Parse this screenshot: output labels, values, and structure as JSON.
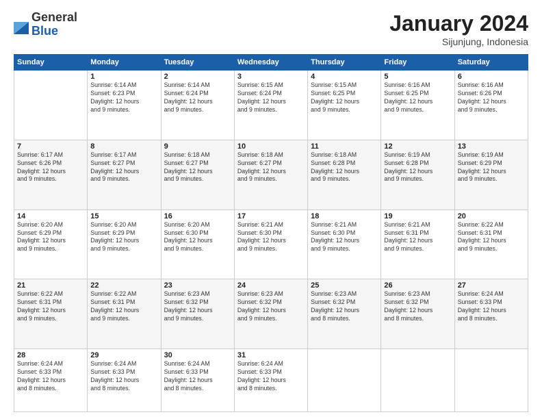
{
  "logo": {
    "general": "General",
    "blue": "Blue"
  },
  "header": {
    "month_year": "January 2024",
    "location": "Sijunjung, Indonesia"
  },
  "days_of_week": [
    "Sunday",
    "Monday",
    "Tuesday",
    "Wednesday",
    "Thursday",
    "Friday",
    "Saturday"
  ],
  "weeks": [
    [
      {
        "day": null,
        "info": null
      },
      {
        "day": "1",
        "info": "Sunrise: 6:14 AM\nSunset: 6:23 PM\nDaylight: 12 hours\nand 9 minutes."
      },
      {
        "day": "2",
        "info": "Sunrise: 6:14 AM\nSunset: 6:24 PM\nDaylight: 12 hours\nand 9 minutes."
      },
      {
        "day": "3",
        "info": "Sunrise: 6:15 AM\nSunset: 6:24 PM\nDaylight: 12 hours\nand 9 minutes."
      },
      {
        "day": "4",
        "info": "Sunrise: 6:15 AM\nSunset: 6:25 PM\nDaylight: 12 hours\nand 9 minutes."
      },
      {
        "day": "5",
        "info": "Sunrise: 6:16 AM\nSunset: 6:25 PM\nDaylight: 12 hours\nand 9 minutes."
      },
      {
        "day": "6",
        "info": "Sunrise: 6:16 AM\nSunset: 6:26 PM\nDaylight: 12 hours\nand 9 minutes."
      }
    ],
    [
      {
        "day": "7",
        "info": "Sunrise: 6:17 AM\nSunset: 6:26 PM\nDaylight: 12 hours\nand 9 minutes."
      },
      {
        "day": "8",
        "info": "Sunrise: 6:17 AM\nSunset: 6:27 PM\nDaylight: 12 hours\nand 9 minutes."
      },
      {
        "day": "9",
        "info": "Sunrise: 6:18 AM\nSunset: 6:27 PM\nDaylight: 12 hours\nand 9 minutes."
      },
      {
        "day": "10",
        "info": "Sunrise: 6:18 AM\nSunset: 6:27 PM\nDaylight: 12 hours\nand 9 minutes."
      },
      {
        "day": "11",
        "info": "Sunrise: 6:18 AM\nSunset: 6:28 PM\nDaylight: 12 hours\nand 9 minutes."
      },
      {
        "day": "12",
        "info": "Sunrise: 6:19 AM\nSunset: 6:28 PM\nDaylight: 12 hours\nand 9 minutes."
      },
      {
        "day": "13",
        "info": "Sunrise: 6:19 AM\nSunset: 6:29 PM\nDaylight: 12 hours\nand 9 minutes."
      }
    ],
    [
      {
        "day": "14",
        "info": "Sunrise: 6:20 AM\nSunset: 6:29 PM\nDaylight: 12 hours\nand 9 minutes."
      },
      {
        "day": "15",
        "info": "Sunrise: 6:20 AM\nSunset: 6:29 PM\nDaylight: 12 hours\nand 9 minutes."
      },
      {
        "day": "16",
        "info": "Sunrise: 6:20 AM\nSunset: 6:30 PM\nDaylight: 12 hours\nand 9 minutes."
      },
      {
        "day": "17",
        "info": "Sunrise: 6:21 AM\nSunset: 6:30 PM\nDaylight: 12 hours\nand 9 minutes."
      },
      {
        "day": "18",
        "info": "Sunrise: 6:21 AM\nSunset: 6:30 PM\nDaylight: 12 hours\nand 9 minutes."
      },
      {
        "day": "19",
        "info": "Sunrise: 6:21 AM\nSunset: 6:31 PM\nDaylight: 12 hours\nand 9 minutes."
      },
      {
        "day": "20",
        "info": "Sunrise: 6:22 AM\nSunset: 6:31 PM\nDaylight: 12 hours\nand 9 minutes."
      }
    ],
    [
      {
        "day": "21",
        "info": "Sunrise: 6:22 AM\nSunset: 6:31 PM\nDaylight: 12 hours\nand 9 minutes."
      },
      {
        "day": "22",
        "info": "Sunrise: 6:22 AM\nSunset: 6:31 PM\nDaylight: 12 hours\nand 9 minutes."
      },
      {
        "day": "23",
        "info": "Sunrise: 6:23 AM\nSunset: 6:32 PM\nDaylight: 12 hours\nand 9 minutes."
      },
      {
        "day": "24",
        "info": "Sunrise: 6:23 AM\nSunset: 6:32 PM\nDaylight: 12 hours\nand 9 minutes."
      },
      {
        "day": "25",
        "info": "Sunrise: 6:23 AM\nSunset: 6:32 PM\nDaylight: 12 hours\nand 8 minutes."
      },
      {
        "day": "26",
        "info": "Sunrise: 6:23 AM\nSunset: 6:32 PM\nDaylight: 12 hours\nand 8 minutes."
      },
      {
        "day": "27",
        "info": "Sunrise: 6:24 AM\nSunset: 6:33 PM\nDaylight: 12 hours\nand 8 minutes."
      }
    ],
    [
      {
        "day": "28",
        "info": "Sunrise: 6:24 AM\nSunset: 6:33 PM\nDaylight: 12 hours\nand 8 minutes."
      },
      {
        "day": "29",
        "info": "Sunrise: 6:24 AM\nSunset: 6:33 PM\nDaylight: 12 hours\nand 8 minutes."
      },
      {
        "day": "30",
        "info": "Sunrise: 6:24 AM\nSunset: 6:33 PM\nDaylight: 12 hours\nand 8 minutes."
      },
      {
        "day": "31",
        "info": "Sunrise: 6:24 AM\nSunset: 6:33 PM\nDaylight: 12 hours\nand 8 minutes."
      },
      {
        "day": null,
        "info": null
      },
      {
        "day": null,
        "info": null
      },
      {
        "day": null,
        "info": null
      }
    ]
  ]
}
